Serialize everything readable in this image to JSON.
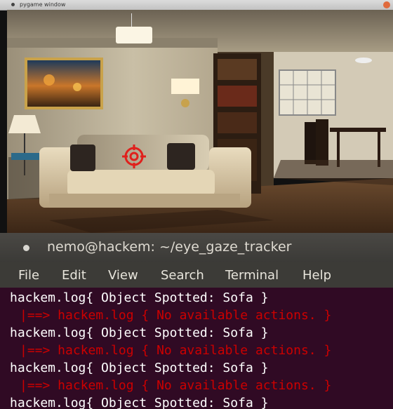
{
  "pygame_window": {
    "title": "pygame window",
    "scene": "living room with sofa, lamps, bookshelf and dining table",
    "target_marker": "crosshair-target-icon",
    "colors": {
      "marker": "#e0201c"
    }
  },
  "terminal": {
    "title": "nemo@hackem: ~/eye_gaze_tracker",
    "menu": [
      "File",
      "Edit",
      "View",
      "Search",
      "Terminal",
      "Help"
    ],
    "lines": [
      {
        "text": "hackem.log{ Object Spotted: Sofa }",
        "color": "white"
      },
      {
        "text": "|==> hackem.log { No available actions. }",
        "color": "red"
      },
      {
        "text": "hackem.log{ Object Spotted: Sofa }",
        "color": "white"
      },
      {
        "text": "|==> hackem.log { No available actions. }",
        "color": "red"
      },
      {
        "text": "hackem.log{ Object Spotted: Sofa }",
        "color": "white"
      },
      {
        "text": "|==> hackem.log { No available actions. }",
        "color": "red"
      },
      {
        "text": "hackem.log{ Object Spotted: Sofa }",
        "color": "white"
      }
    ],
    "colors": {
      "background": "#300a24",
      "error_text": "#cc0000",
      "text": "#ffffff"
    }
  }
}
